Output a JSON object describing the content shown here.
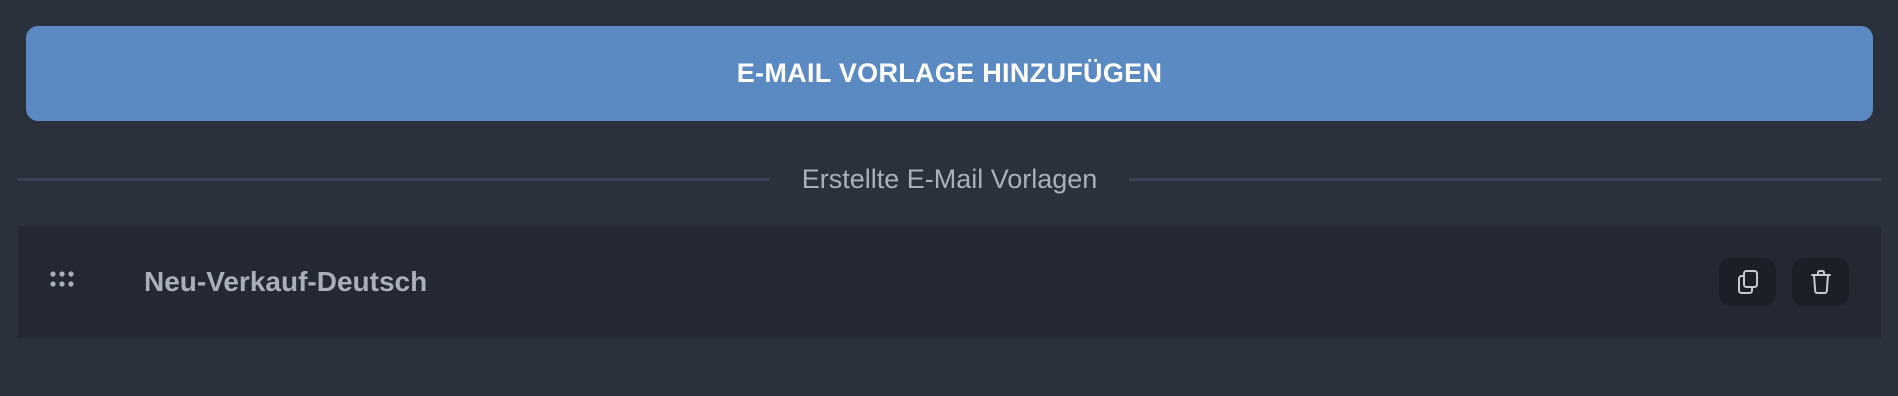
{
  "actions": {
    "add_template_label": "E-MAIL VORLAGE HINZUFÜGEN"
  },
  "section": {
    "title": "Erstellte E-Mail Vorlagen"
  },
  "templates": [
    {
      "name": "Neu-Verkauf-Deutsch",
      "icons": {
        "drag": "drag-handle-icon",
        "copy": "copy-icon",
        "delete": "trash-icon"
      }
    }
  ],
  "colors": {
    "background": "#2a303c",
    "primary_button": "#5b8ac2",
    "row_background": "#232833",
    "icon_button_background": "#1b1f27",
    "muted_text": "#a9afbb"
  }
}
